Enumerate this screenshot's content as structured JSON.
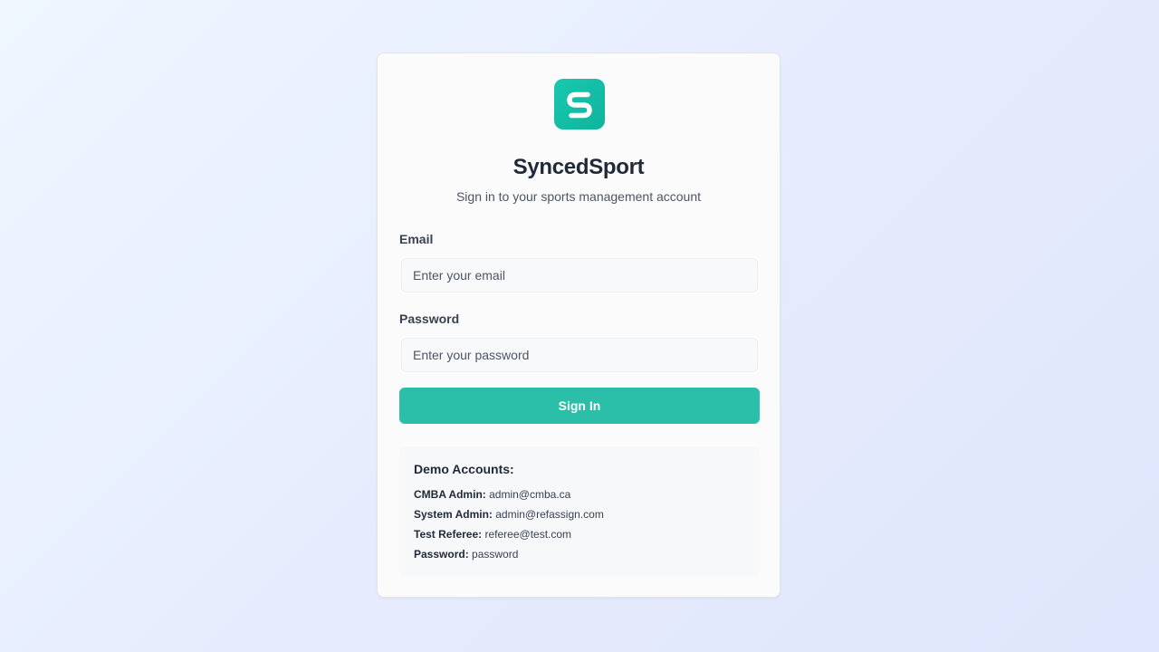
{
  "brand": {
    "logo_letter": "S",
    "name": "SyncedSport",
    "tagline": "Sign in to your sports management account",
    "accent_color": "#2bbfaa"
  },
  "form": {
    "email_label": "Email",
    "email_placeholder": "Enter your email",
    "password_label": "Password",
    "password_placeholder": "Enter your password",
    "submit_label": "Sign In"
  },
  "demo": {
    "title": "Demo Accounts:",
    "accounts": [
      {
        "role": "CMBA Admin:",
        "value": "admin@cmba.ca"
      },
      {
        "role": "System Admin:",
        "value": "admin@refassign.com"
      },
      {
        "role": "Test Referee:",
        "value": "referee@test.com"
      },
      {
        "role": "Password:",
        "value": "password"
      }
    ]
  }
}
